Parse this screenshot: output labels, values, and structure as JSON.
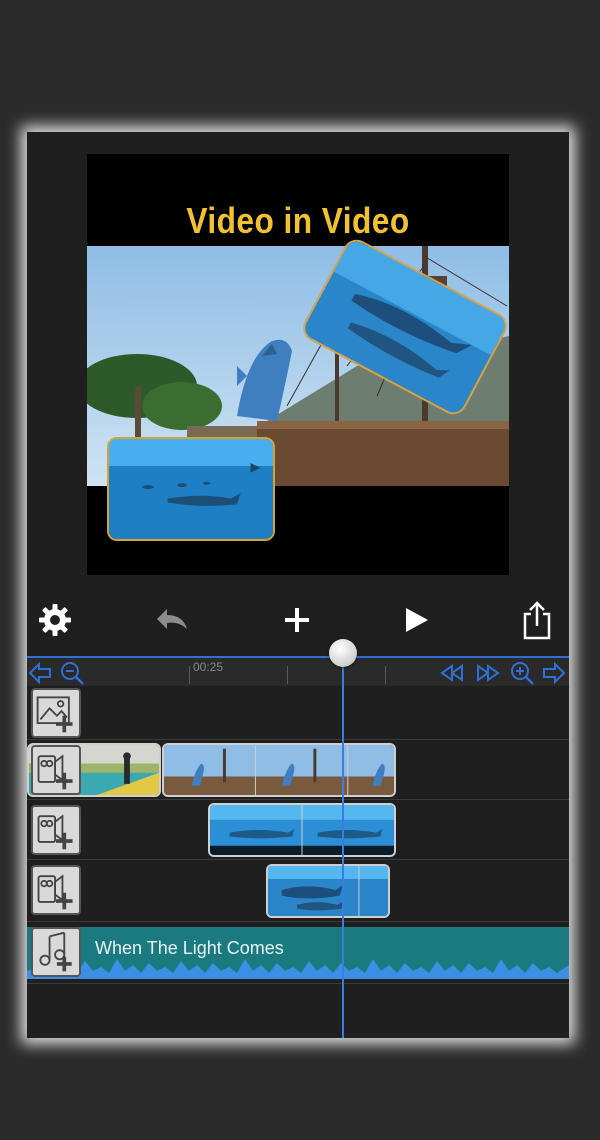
{
  "project": {
    "title": "Video in Video",
    "title_color": "#f2c12e"
  },
  "toolbar": {
    "settings_icon": "gear-icon",
    "undo_icon": "undo-arrow-icon",
    "add_icon": "plus-icon",
    "play_icon": "play-icon",
    "share_icon": "share-icon"
  },
  "timeline": {
    "time_marker": "00:25",
    "accent_color": "#3d7be0",
    "tracks": [
      {
        "type": "image",
        "icon": "image-add-icon"
      },
      {
        "type": "video",
        "icon": "video-add-icon"
      },
      {
        "type": "video",
        "icon": "video-add-icon"
      },
      {
        "type": "video",
        "icon": "video-add-icon"
      }
    ],
    "audio": {
      "icon": "music-add-icon",
      "title": "When The Light Comes",
      "color": "#1b7a80"
    }
  }
}
